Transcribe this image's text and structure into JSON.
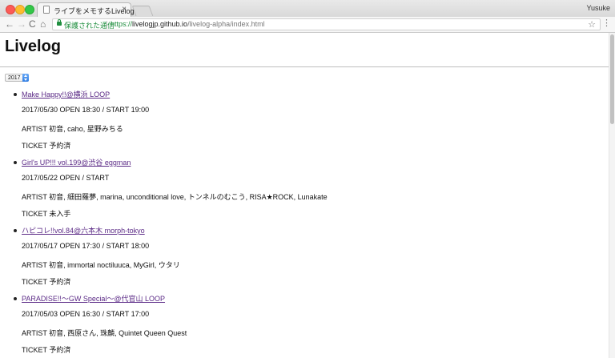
{
  "browser": {
    "tab_title": "ライブをメモするLivelog",
    "tab_close": "×",
    "profile_name": "Yusuke",
    "secure_label": "保護された通信",
    "url_scheme": "https://",
    "url_host": "livelogjp.github.io",
    "url_path": "/livelog-alpha/index.html",
    "nav_icons": {
      "back": "←",
      "forward": "→",
      "reload": "C",
      "home": "⌂",
      "star": "☆",
      "menu": "⋮"
    },
    "colors": {
      "secure": "#1e8e3e",
      "link": "#5b2a86"
    }
  },
  "page": {
    "title": "Livelog",
    "year_select": {
      "selected": "2017"
    },
    "lives": [
      {
        "title": "Make Happy!!@横浜 LOOP",
        "date_line": "2017/05/30 OPEN 18:30 / START 19:00",
        "artist_line": "ARTIST 初音, caho, 星野みちる",
        "ticket_line": "TICKET 予約済"
      },
      {
        "title": "Girl's UP!!! vol.199@渋谷 eggman",
        "date_line": "2017/05/22 OPEN / START",
        "artist_line": "ARTIST 初音, 細田羅夢, marina, unconditional love, トンネルのむこう, RISA★ROCK, Lunakate",
        "ticket_line": "TICKET 未入手"
      },
      {
        "title": "ハピコレ!!vol.84@六本木 morph-tokyo",
        "date_line": "2017/05/17 OPEN 17:30 / START 18:00",
        "artist_line": "ARTIST 初音, immortal noctiluuca, MyGirl, ウタリ",
        "ticket_line": "TICKET 予約済"
      },
      {
        "title": "PARADISE!!～GW Special～@代官山 LOOP",
        "date_line": "2017/05/03 OPEN 16:30 / START 17:00",
        "artist_line": "ARTIST 初音, 西原さん, 珠麟, Quintet Queen Quest",
        "ticket_line": "TICKET 予約済"
      }
    ]
  }
}
